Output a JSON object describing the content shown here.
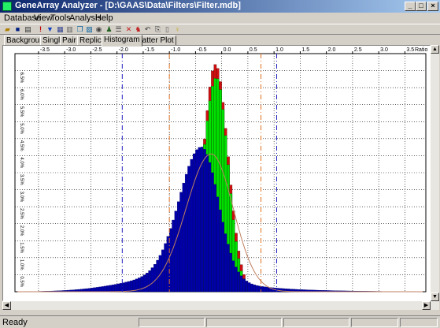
{
  "window": {
    "title": "GeneArray Analyzer - [D:\\GAAS\\Data\\Filters\\Filter.mdb]",
    "min_label": "_",
    "max_label": "□",
    "close_label": "×"
  },
  "menu": [
    "Database",
    "View",
    "Tools",
    "Analysis",
    "Help"
  ],
  "toolbar_icons": [
    "open-icon",
    "save-icon",
    "print-icon",
    "exclaim-icon",
    "filter-icon",
    "grid-icon",
    "chart-icon",
    "copy-icon",
    "export-icon",
    "binoculars-icon",
    "person-icon",
    "table-icon",
    "graph-icon",
    "users-icon",
    "undo-icon",
    "redo-icon",
    "help-page-icon",
    "lightbulb-icon"
  ],
  "tabs": {
    "items": [
      "Background",
      "Single",
      "Pair",
      "Replicas",
      "Histogram",
      "Scatter Plot"
    ],
    "active": "Histogram"
  },
  "status": {
    "text": "Ready"
  },
  "colors": {
    "all": "#0000a8",
    "filtered": "#00e000",
    "excess": "#d01010",
    "fit_line": "#c08060",
    "threshold_blue": "#2020c0",
    "threshold_orange": "#e07020"
  },
  "chart_data": {
    "type": "bar",
    "xlabel": "Ratio",
    "x_ticks": [
      "-3.5",
      "-3.0",
      "-2.5",
      "-2.0",
      "-1.5",
      "-1.0",
      "-0.5",
      "0.0",
      "0.5",
      "1.0",
      "1.5",
      "2.0",
      "2.5",
      "3.0",
      "3.5"
    ],
    "y_ticks": [
      "0.5",
      "1.0",
      "1.5",
      "2.0",
      "2.5",
      "3.0",
      "3.5",
      "4.0",
      "4.5",
      "5.0",
      "5.5",
      "6.0",
      "6.5"
    ],
    "ylabel_suffix": "%",
    "xlim": [
      -3.95,
      3.9
    ],
    "ylim": [
      0,
      7.0
    ],
    "grid": true,
    "thresholds": {
      "blue": [
        -1.9,
        1.05
      ],
      "orange": [
        -1.0,
        0.75
      ]
    },
    "bin_width": 0.05,
    "series": [
      {
        "role": "all",
        "color": "#0000a8"
      },
      {
        "role": "filtered",
        "color": "#00e000"
      },
      {
        "role": "excess",
        "color": "#d01010"
      }
    ]
  }
}
